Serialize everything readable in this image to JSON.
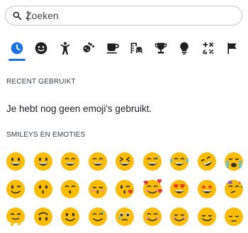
{
  "search": {
    "placeholder": "Zoeken",
    "value": ""
  },
  "categories": [
    {
      "name": "recent",
      "icon": "clock-icon",
      "active": true
    },
    {
      "name": "smileys",
      "icon": "smiley-icon"
    },
    {
      "name": "people",
      "icon": "person-icon"
    },
    {
      "name": "animals",
      "icon": "paw-icon"
    },
    {
      "name": "food",
      "icon": "cup-icon"
    },
    {
      "name": "travel",
      "icon": "building-car-icon"
    },
    {
      "name": "activities",
      "icon": "trophy-icon"
    },
    {
      "name": "objects",
      "icon": "lightbulb-icon"
    },
    {
      "name": "symbols",
      "icon": "symbols-icon"
    },
    {
      "name": "flags",
      "icon": "flag-icon"
    }
  ],
  "recent": {
    "title": "RECENT GEBRUIKT",
    "empty_text": "Je hebt nog geen emoji's gebruikt."
  },
  "smileys": {
    "title": "SMILEYS EN EMOTIES",
    "rows": [
      [
        "😀",
        "😃",
        "😄",
        "😁",
        "😆",
        "😅",
        "😂",
        "🤣",
        "😭"
      ],
      [
        "😉",
        "😗",
        "😙",
        "😚",
        "😘",
        "🥰",
        "😍",
        "🤩",
        "🥳"
      ],
      [
        "🫠",
        "🙃",
        "🙂",
        "🥲",
        "🥹",
        "😊",
        "☺️",
        "😌",
        "😔"
      ]
    ]
  },
  "colors": {
    "accent": "#1a73e8",
    "icon": "#1f1f1f",
    "emoji_face": "#fbbc04"
  }
}
